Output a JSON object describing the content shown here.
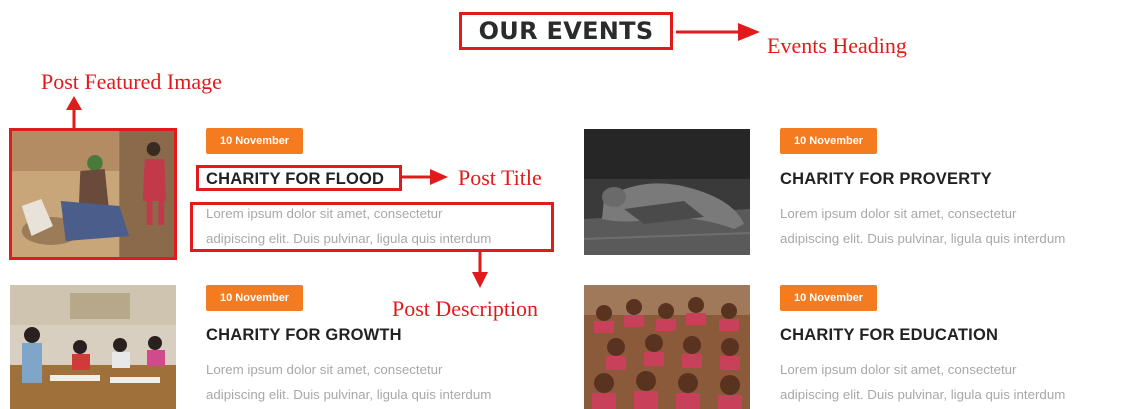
{
  "section": {
    "heading": "OUR EVENTS"
  },
  "annotations": {
    "events_heading": "Events Heading",
    "post_featured_image": "Post Featured Image",
    "post_title": "Post Title",
    "post_description": "Post Description"
  },
  "posts": [
    {
      "date": "10 November",
      "title": "CHARITY FOR FLOOD",
      "desc_line1": "Lorem ipsum dolor sit amet, consectetur",
      "desc_line2": "adipiscing elit. Duis pulvinar, ligula quis interdum"
    },
    {
      "date": "10 November",
      "title": "CHARITY FOR PROVERTY",
      "desc_line1": "Lorem ipsum dolor sit amet, consectetur",
      "desc_line2": "adipiscing elit. Duis pulvinar, ligula quis interdum"
    },
    {
      "date": "10 November",
      "title": "CHARITY FOR GROWTH",
      "desc_line1": "Lorem ipsum dolor sit amet, consectetur",
      "desc_line2": "adipiscing elit. Duis pulvinar, ligula quis interdum"
    },
    {
      "date": "10 November",
      "title": "CHARITY FOR EDUCATION",
      "desc_line1": "Lorem ipsum dolor sit amet, consectetur",
      "desc_line2": "adipiscing elit. Duis pulvinar, ligula quis interdum"
    }
  ],
  "colors": {
    "badge": "#f47b20",
    "annotation": "#e21a1a",
    "title": "#222222",
    "description": "#a8a8a8"
  }
}
